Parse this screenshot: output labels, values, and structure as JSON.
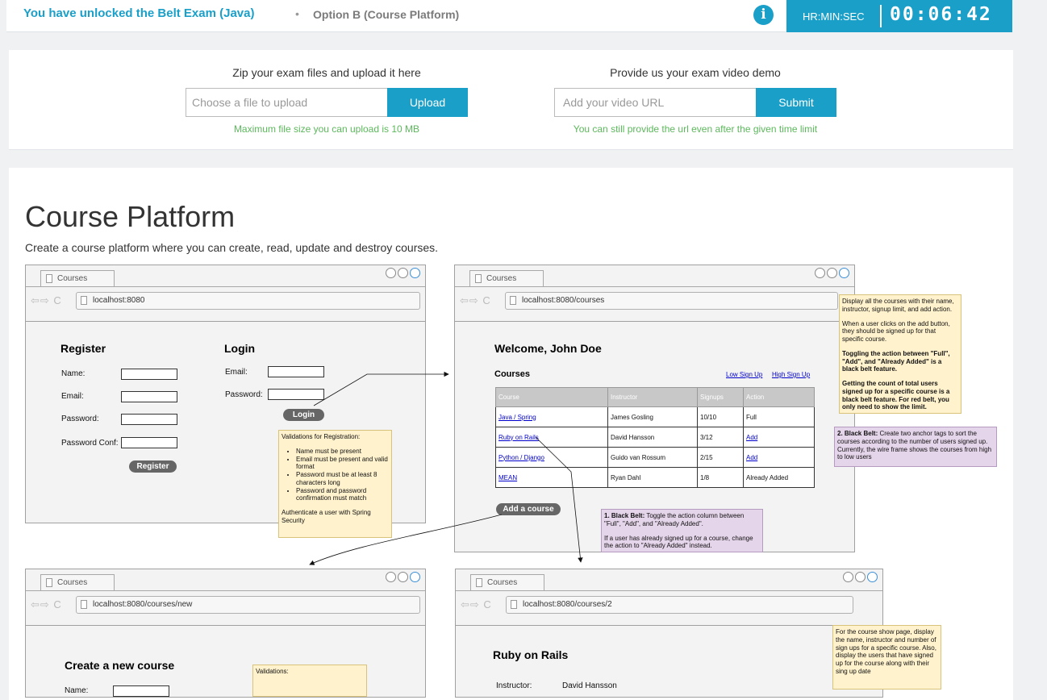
{
  "header": {
    "exam_title": "You have unlocked the Belt Exam (Java)",
    "separator": "•",
    "option": "Option B (Course Platform)",
    "info_icon": "i",
    "timer_label": "HR:MIN:SEC",
    "timer_value": "00:06:42"
  },
  "upload": {
    "files_heading": "Zip your exam files and upload it here",
    "files_placeholder": "Choose a file to upload",
    "files_button": "Upload",
    "files_hint": "Maximum file size you can upload is 10 MB",
    "video_heading": "Provide us your exam video demo",
    "video_placeholder": "Add your video URL",
    "video_button": "Submit",
    "video_hint": "You can still provide the url even after the given time limit"
  },
  "main": {
    "title": "Course Platform",
    "description": "Create a course platform where you can create, read, update and destroy courses."
  },
  "wireframes": {
    "tab_label": "Courses",
    "nav_glyphs": "⇦⇨ C",
    "login_page": {
      "url": "localhost:8080",
      "register_title": "Register",
      "name_label": "Name:",
      "email_label": "Email:",
      "password_label": "Password:",
      "password_conf_label": "Password Conf:",
      "register_button": "Register",
      "login_title": "Login",
      "login_email_label": "Email:",
      "login_password_label": "Password:",
      "login_button": "Login"
    },
    "courses_page": {
      "url": "localhost:8080/courses",
      "welcome": "Welcome, John Doe",
      "courses_title": "Courses",
      "low_signup_link": "Low Sign Up",
      "high_signup_link": "High Sign Up",
      "columns": [
        "Course",
        "Instructor",
        "Signups",
        "Action"
      ],
      "rows": [
        {
          "course": "Java / Spring",
          "instructor": "James Gosling",
          "signups": "10/10",
          "action": "Full"
        },
        {
          "course": "Ruby on Rails",
          "instructor": "David Hansson",
          "signups": "3/12",
          "action": "Add"
        },
        {
          "course": "Python / Django",
          "instructor": "Guido van Rossum",
          "signups": "2/15",
          "action": "Add"
        },
        {
          "course": "MEAN",
          "instructor": "Ryan Dahl",
          "signups": "1/8",
          "action": "Already Added"
        }
      ],
      "add_course_button": "Add a course"
    },
    "new_course_page": {
      "url": "localhost:8080/courses/new",
      "title": "Create a new course",
      "name_label": "Name:"
    },
    "show_page": {
      "url": "localhost:8080/courses/2",
      "title": "Ruby on Rails",
      "instructor_label": "Instructor:",
      "instructor_value": "David Hansson"
    }
  },
  "notes": {
    "registration": {
      "title": "Validations for Registration:",
      "items": [
        "Name must be present",
        "Email must be present and valid format",
        "Password must be at least 8 characters long",
        "Password and password confirmation must match"
      ],
      "footer": "Authenticate a user with Spring Security"
    },
    "courses_list": {
      "p1": "Display all the courses with their name, instructor, signup limit, and add action.",
      "p2": "When a user clicks on the add button, they should be signed up for that specific course.",
      "p3": "Toggling the action between \"Full\", \"Add\", and \"Already Added\" is a black belt feature.",
      "p4": "Getting the count of total users signed up for a specific course is a black belt feature. For red belt, you only need to show the limit."
    },
    "black_belt_sort": {
      "label": "2. Black Belt:",
      "text": "Create two anchor tags to sort the courses according to the number of users signed up. Currently, the wire frame shows the courses from high to low users"
    },
    "black_belt_toggle": {
      "label": "1. Black Belt:",
      "text": "Toggle the action column between \"Full\", \"Add\", and \"Already Added\".",
      "p2": "If a user has already signed up for a course, change the action to \"Already Added\" instead."
    },
    "new_course": {
      "title": "Validations:"
    },
    "show_page": {
      "text": "For the course show page, display the name, instructor and number of sign ups for a specific course. Also, display the users that have signed up for the course along with their sing up date"
    }
  }
}
